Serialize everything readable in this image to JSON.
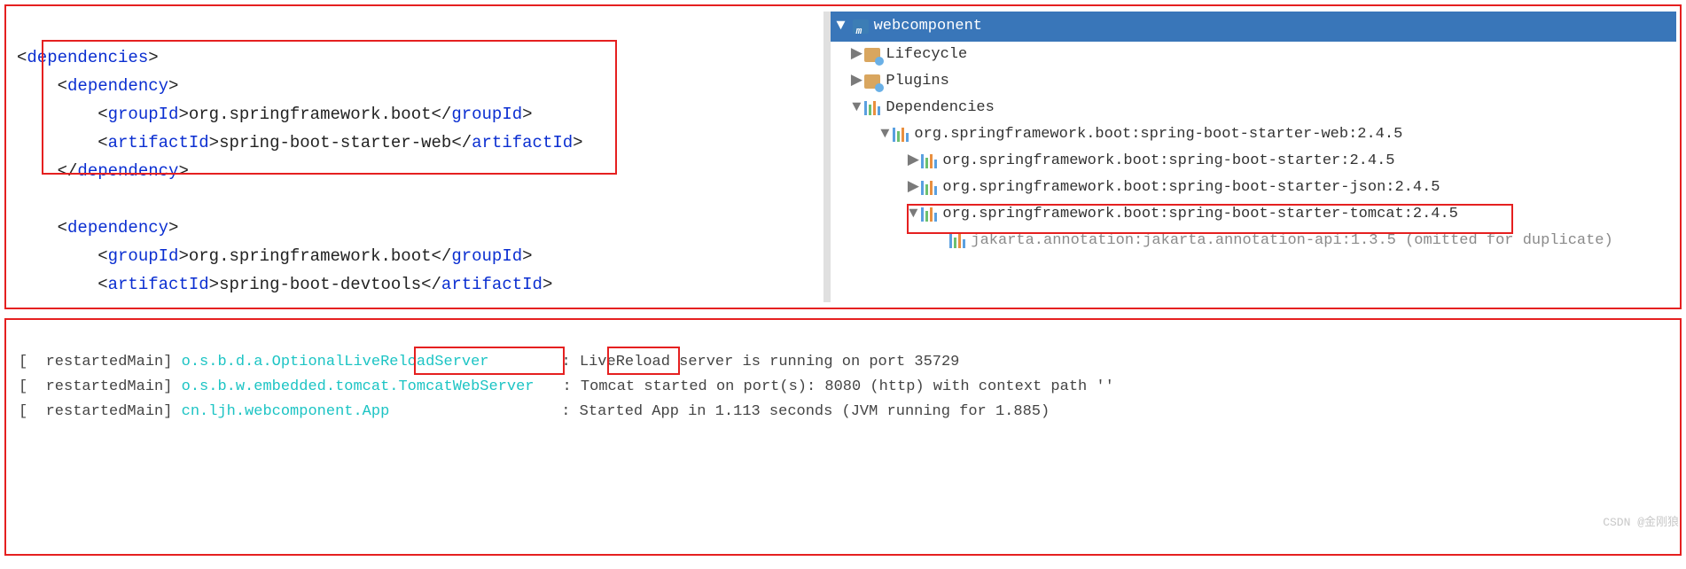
{
  "pom": {
    "root_open": "dependencies",
    "dep1": {
      "open": "dependency",
      "groupId_tag": "groupId",
      "groupId_val": "org.springframework.boot",
      "artifactId_tag": "artifactId",
      "artifactId_val": "spring-boot-starter-web",
      "close": "dependency"
    },
    "dep2": {
      "open": "dependency",
      "groupId_tag": "groupId",
      "groupId_val": "org.springframework.boot",
      "artifactId_tag": "artifactId",
      "artifactId_val": "spring-boot-devtools"
    }
  },
  "tree": {
    "root": "webcomponent",
    "lifecycle": "Lifecycle",
    "plugins": "Plugins",
    "dependencies": "Dependencies",
    "lib1": "org.springframework.boot:spring-boot-starter-web:2.4.5",
    "lib2": "org.springframework.boot:spring-boot-starter:2.4.5",
    "lib3": "org.springframework.boot:spring-boot-starter-json:2.4.5",
    "lib4": "org.springframework.boot:spring-boot-starter-tomcat:2.4.5",
    "lib5": "jakarta.annotation:jakarta.annotation-api:1.3.5 (omitted for duplicate)"
  },
  "console": {
    "l1_thread": "[  restartedMain] ",
    "l1_logger": "o.s.b.d.a.OptionalLiveReloadServer",
    "l1_msg": ": LiveReload server is running on port 35729",
    "l2_thread": "[  restartedMain] ",
    "l2_logger_a": "o.s.b.w.embedded.tomcat.",
    "l2_logger_b": "TomcatWebServer",
    "l2_msg_a": ": ",
    "l2_msg_b": "Tomcat ",
    "l2_msg_c": "started on port(s): 8080 (http) with context path ''",
    "l3_thread": "[  restartedMain] ",
    "l3_logger": "cn.ljh.webcomponent.App",
    "l3_msg": ": Started App in 1.113 seconds (JVM running for 1.885)"
  },
  "watermark": "CSDN @金刚狼"
}
